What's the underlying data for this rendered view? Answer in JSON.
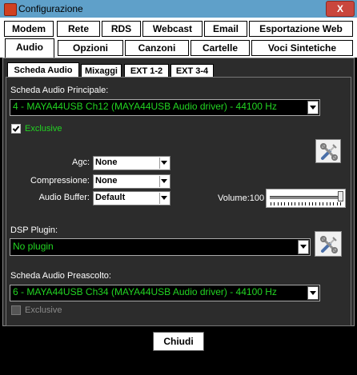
{
  "window": {
    "title": "Configurazione",
    "close_label": "X"
  },
  "main_tabs_row1": [
    {
      "label": "Modem"
    },
    {
      "label": "Rete"
    },
    {
      "label": "RDS"
    },
    {
      "label": "Webcast"
    },
    {
      "label": "Email"
    },
    {
      "label": "Esportazione Web"
    }
  ],
  "main_tabs_row2": [
    {
      "label": "Audio",
      "selected": true
    },
    {
      "label": "Opzioni"
    },
    {
      "label": "Canzoni"
    },
    {
      "label": "Cartelle"
    },
    {
      "label": "Voci Sintetiche"
    }
  ],
  "sub_tabs": [
    {
      "label": "Scheda Audio",
      "selected": true
    },
    {
      "label": "Mixaggi"
    },
    {
      "label": "EXT 1-2"
    },
    {
      "label": "EXT 3-4"
    }
  ],
  "audio": {
    "main_device_label": "Scheda Audio Principale:",
    "main_device_value": "4 - MAYA44USB Ch12 (MAYA44USB Audio driver) - 44100 Hz",
    "exclusive_label": "Exclusive",
    "exclusive_checked": true,
    "agc_label": "Agc:",
    "agc_value": "None",
    "compression_label": "Compressione:",
    "compression_value": "None",
    "buffer_label": "Audio Buffer:",
    "buffer_value": "Default",
    "volume_label": "Volume:100",
    "volume_fraction": 1.0,
    "dsp_label": "DSP Plugin:",
    "dsp_value": "No plugin",
    "preview_device_label": "Scheda Audio Preascolto:",
    "preview_device_value": "6 - MAYA44USB Ch34 (MAYA44USB Audio driver) - 44100 Hz",
    "preview_exclusive_label": "Exclusive",
    "preview_exclusive_checked": false
  },
  "footer": {
    "close_button_label": "Chiudi"
  },
  "colors": {
    "value_text": "#22d422",
    "panel_bg": "#2c2c2c",
    "titlebar": "#5fa0c9"
  },
  "icons": {
    "settings_tool": "wrench-screwdriver-icon"
  }
}
